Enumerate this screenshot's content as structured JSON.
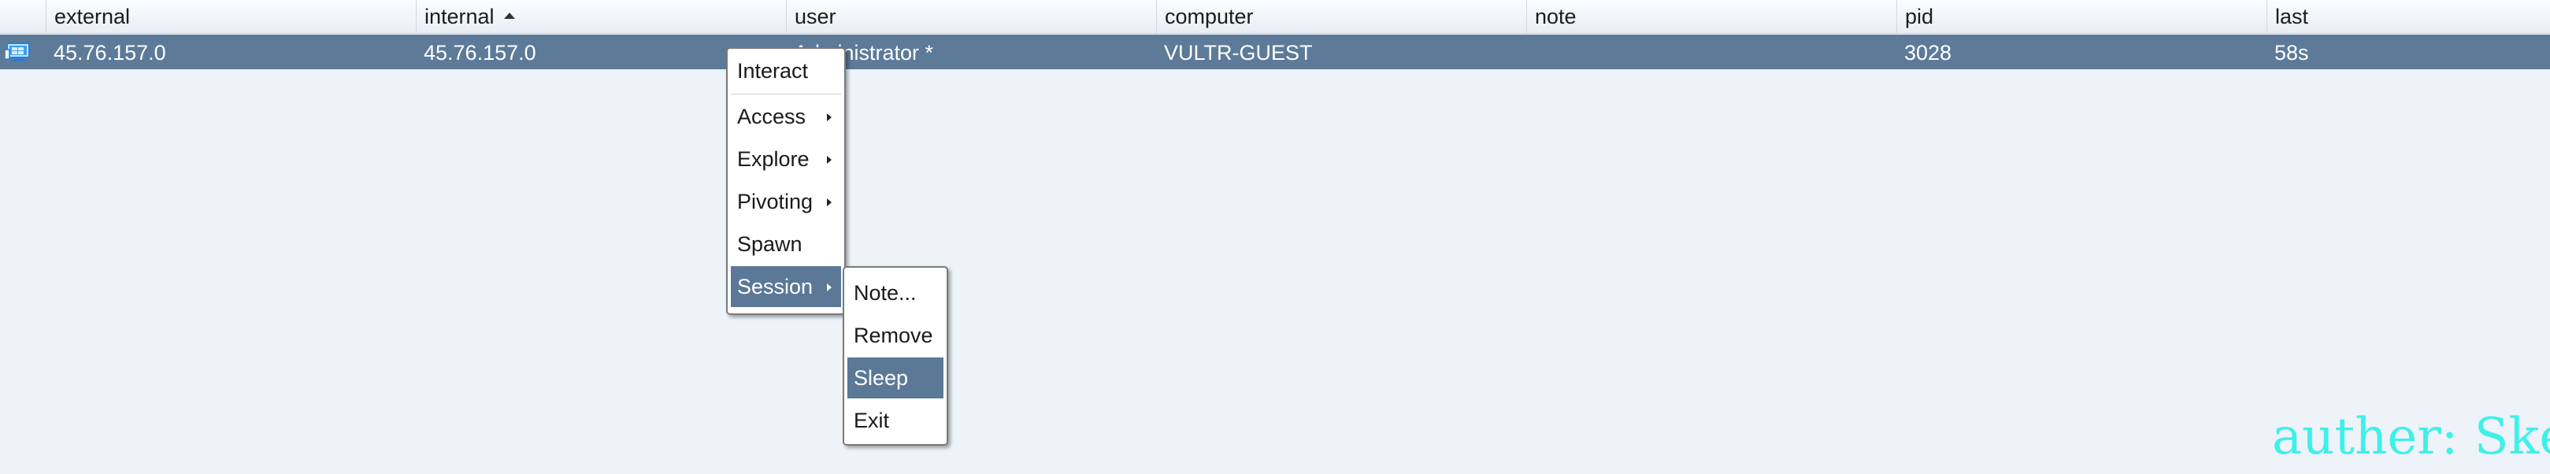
{
  "table": {
    "columns": [
      "external",
      "internal",
      "user",
      "computer",
      "note",
      "pid",
      "last"
    ],
    "sorted_column": "internal",
    "sort_direction": "ascending",
    "selected_row": {
      "icon": "windows-host-icon",
      "external": "45.76.157.0",
      "internal": "45.76.157.0",
      "user": "Administrator *",
      "computer": "VULTR-GUEST",
      "note": "",
      "pid": "3028",
      "last": "58s"
    }
  },
  "context_menu": {
    "items": [
      {
        "label": "Interact",
        "submenu": false
      },
      {
        "label": "Access",
        "submenu": true
      },
      {
        "label": "Explore",
        "submenu": true
      },
      {
        "label": "Pivoting",
        "submenu": true
      },
      {
        "label": "Spawn",
        "submenu": false
      },
      {
        "label": "Session",
        "submenu": true,
        "active": true
      }
    ]
  },
  "session_submenu": {
    "items": [
      {
        "label": "Note..."
      },
      {
        "label": "Remove"
      },
      {
        "label": "Sleep",
        "active": true
      },
      {
        "label": "Exit"
      }
    ]
  },
  "watermark": "auther: Ske",
  "colors": {
    "selection": "#5d7a99",
    "background": "#eef3fa",
    "watermark": "#3ff0ea"
  }
}
